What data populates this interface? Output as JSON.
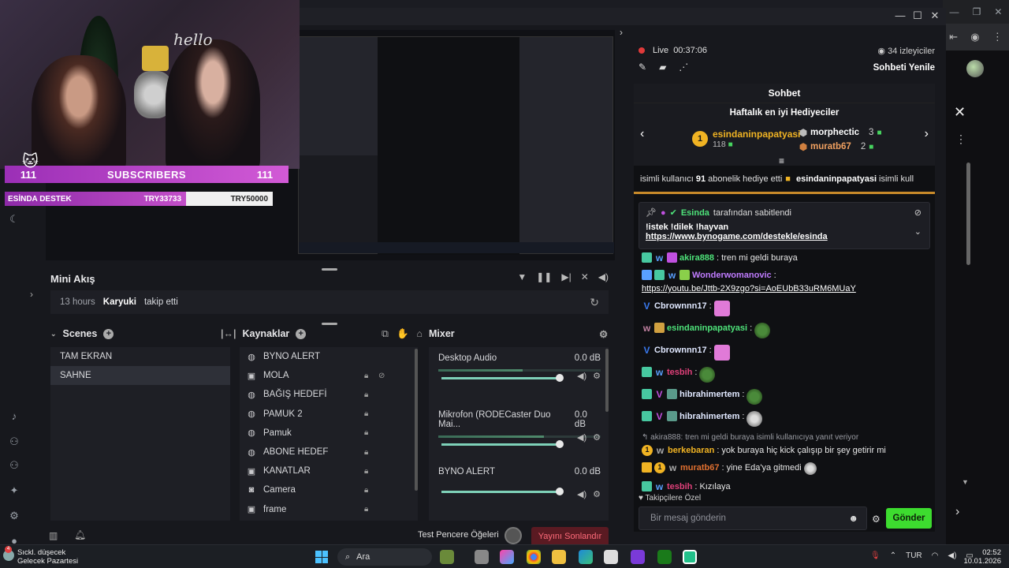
{
  "overlay": {
    "sign_text": "hello",
    "sub_left": "111",
    "sub_label": "SUBSCRIBERS",
    "sub_right": "111",
    "destek_label": "ESİNDA DESTEK",
    "destek_code1": "TRY33733",
    "destek_code2": "TRY50000"
  },
  "preview_mini": {
    "end_label": "Yayını Sonlandır",
    "test_label": "Test Pencere Öğeleri"
  },
  "mini_feed": {
    "title": "Mini Akış",
    "time": "13 hours",
    "user": "Karyuki",
    "action": "takip etti"
  },
  "scenes": {
    "title": "Scenes",
    "items": [
      "TAM EKRAN",
      "SAHNE"
    ]
  },
  "sources": {
    "title": "Kaynaklar",
    "items": [
      "BYNO ALERT",
      "MOLA",
      "BAĞIŞ HEDEFİ",
      "PAMUK 2",
      "Pamuk",
      "ABONE HEDEF",
      "KANATLAR",
      "Camera",
      "frame"
    ]
  },
  "mixer": {
    "title": "Mixer",
    "channels": [
      {
        "name": "Desktop Audio",
        "db": "0.0 dB",
        "level": 0.52
      },
      {
        "name": "Mikrofon (RODECaster Duo Mai...",
        "db": "0.0 dB",
        "level": 0.65
      },
      {
        "name": "BYNO ALERT",
        "db": "0.0 dB",
        "level": 0
      }
    ]
  },
  "bottom": {
    "test_label": "Test Pencere Öğeleri",
    "end_label": "Yayını Sonlandır"
  },
  "chat": {
    "live_label": "Live",
    "live_time": "00:37:06",
    "viewers": "34 izleyiciler",
    "refresh": "Sohbeti Yenile",
    "header": "Sohbet",
    "gifters_title": "Haftalık en iyi Hediyeciler",
    "top_gifter": {
      "rank": "1",
      "name": "esindaninpapatyasi",
      "count": "118"
    },
    "gifter2": {
      "name": "morphectic",
      "count": "3"
    },
    "gifter3": {
      "name": "muratb67",
      "count": "2"
    },
    "ticker_pre": "isimli kullanıcı",
    "ticker_num": "91",
    "ticker_mid": "abonelik hediye etti",
    "ticker_name": "esindaninpapatyasi",
    "ticker_post": "isimli kull",
    "pinned_by": "Esinda",
    "pinned_suffix": "tarafından sabitlendi",
    "pinned_msg": "!istek !dilek !hayvan",
    "pinned_link": "https://www.bynogame.com/destekle/esinda",
    "messages": [
      {
        "user": "akira888",
        "color": "#4ee37a",
        "text": "tren mi geldi buraya"
      },
      {
        "user": "Wonderwomanovic",
        "color": "#c07cff",
        "text": "https://youtu.be/Jttb-2X9zgo?si=AoEUbB33uRM6MUaY"
      },
      {
        "user": "Cbrownnn17",
        "color": "#e0e8ff",
        "text": ""
      },
      {
        "user": "esindaninpapatyasi",
        "color": "#4ee37a",
        "text": ""
      },
      {
        "user": "Cbrownnn17",
        "color": "#e0e8ff",
        "text": ""
      },
      {
        "user": "tesbih",
        "color": "#e0407a",
        "text": ""
      },
      {
        "user": "hibrahimertem",
        "color": "#e0e8ff",
        "text": ""
      },
      {
        "user": "hibrahimertem",
        "color": "#e0e8ff",
        "text": ""
      },
      {
        "reply": "akira888: tren mi geldi buraya isimli kullanıcıya yanıt veriyor",
        "user": "berkebaran",
        "color": "#f0b323",
        "text": "yok buraya hiç kick çalışıp bir şey getirir mi"
      },
      {
        "user": "muratb67",
        "color": "#e07030",
        "text": "yine Eda'ya gitmedi"
      },
      {
        "user": "tesbih",
        "color": "#e0407a",
        "text": "Kızılaya"
      }
    ],
    "followers_only": "Takipçilere Özel",
    "input_placeholder": "Bir mesaj gönderin",
    "send": "Gönder"
  },
  "taskbar": {
    "weather_line1": "Sıckl. düşecek",
    "weather_line2": "Gelecek Pazartesi",
    "notif_count": "4",
    "search": "Ara",
    "lang": "TUR",
    "time": "02:52",
    "date": "10.01.2026"
  },
  "colors": {
    "accent_green": "#3ddc2f",
    "live_red": "#e03a3a",
    "gold": "#f0b323",
    "sub_purple": "#9b2fb6"
  }
}
